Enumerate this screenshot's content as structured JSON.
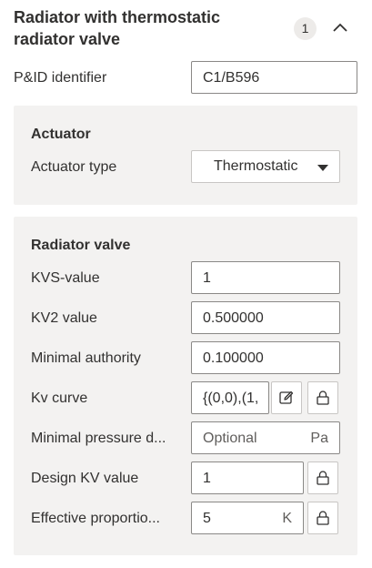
{
  "header": {
    "title_line1": "Radiator with thermostatic",
    "title_line2": "radiator valve",
    "badge_count": "1",
    "collapse_icon": "chevron-up-icon"
  },
  "pid": {
    "label": "P&ID identifier",
    "value": "C1/B596"
  },
  "actuator": {
    "title": "Actuator",
    "type_label": "Actuator type",
    "type_value": "Thermostatic",
    "dropdown_icon": "caret-down-icon"
  },
  "radiator_valve": {
    "title": "Radiator valve",
    "kvs": {
      "label": "KVS-value",
      "value": "1"
    },
    "kv2": {
      "label": "KV2 value",
      "value": "0.500000"
    },
    "authority": {
      "label": "Minimal authority",
      "value": "0.100000"
    },
    "kv_curve": {
      "label": "Kv curve",
      "value": "{(0,0),(1,",
      "edit_icon": "edit-icon",
      "lock_icon": "lock-icon"
    },
    "min_pressure": {
      "label": "Minimal pressure d...",
      "placeholder": "Optional",
      "unit": "Pa"
    },
    "design_kv": {
      "label": "Design KV value",
      "value": "1",
      "lock_icon": "lock-icon"
    },
    "effective": {
      "label": "Effective proportio...",
      "value": "5",
      "unit": "K",
      "lock_icon": "lock-icon"
    }
  },
  "colors": {
    "panel_bg": "#f3f2f1",
    "text": "#323130",
    "border": "#8a8886",
    "badge_bg": "#edebe9"
  }
}
